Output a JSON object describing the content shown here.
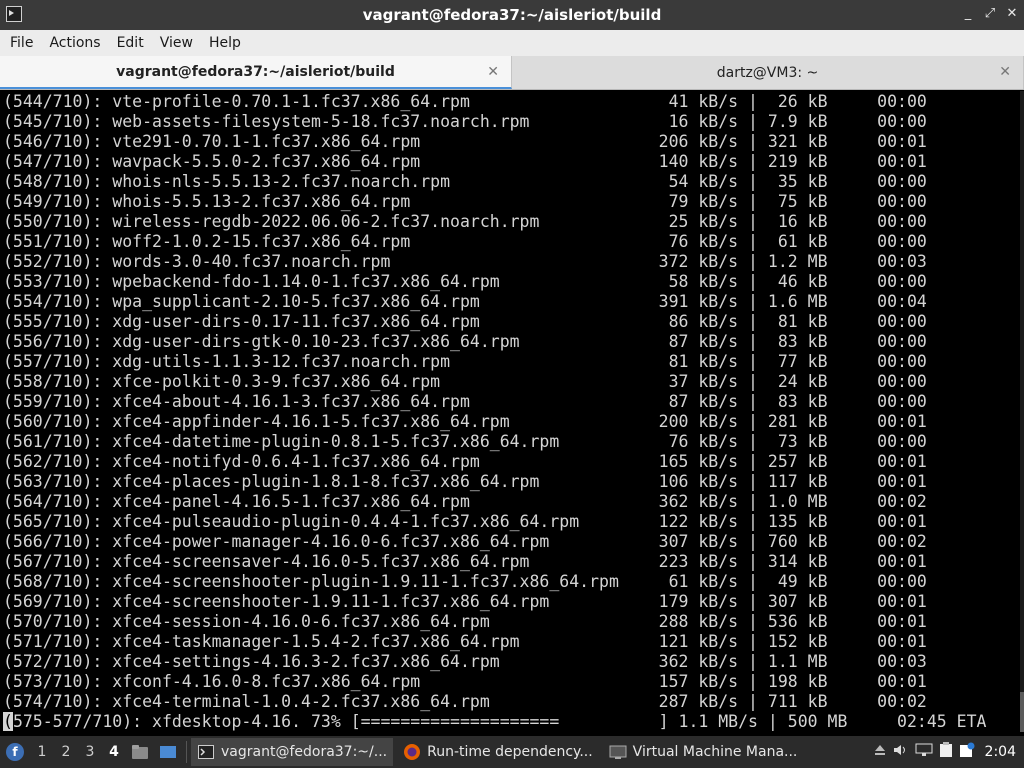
{
  "window": {
    "title": "vagrant@fedora37:~/aisleriot/build",
    "controls": [
      "_",
      "⤢",
      "✕"
    ]
  },
  "menubar": {
    "items": [
      "File",
      "Actions",
      "Edit",
      "View",
      "Help"
    ]
  },
  "tabs": [
    {
      "label": "vagrant@fedora37:~/aisleriot/build",
      "active": true
    },
    {
      "label": "dartz@VM3: ~",
      "active": false
    }
  ],
  "terminal": {
    "lines": [
      "(544/710): vte-profile-0.70.1-1.fc37.x86_64.rpm                    41 kB/s |  26 kB     00:00",
      "(545/710): web-assets-filesystem-5-18.fc37.noarch.rpm              16 kB/s | 7.9 kB     00:00",
      "(546/710): vte291-0.70.1-1.fc37.x86_64.rpm                        206 kB/s | 321 kB     00:01",
      "(547/710): wavpack-5.5.0-2.fc37.x86_64.rpm                        140 kB/s | 219 kB     00:01",
      "(548/710): whois-nls-5.5.13-2.fc37.noarch.rpm                      54 kB/s |  35 kB     00:00",
      "(549/710): whois-5.5.13-2.fc37.x86_64.rpm                          79 kB/s |  75 kB     00:00",
      "(550/710): wireless-regdb-2022.06.06-2.fc37.noarch.rpm             25 kB/s |  16 kB     00:00",
      "(551/710): woff2-1.0.2-15.fc37.x86_64.rpm                          76 kB/s |  61 kB     00:00",
      "(552/710): words-3.0-40.fc37.noarch.rpm                           372 kB/s | 1.2 MB     00:03",
      "(553/710): wpebackend-fdo-1.14.0-1.fc37.x86_64.rpm                 58 kB/s |  46 kB     00:00",
      "(554/710): wpa_supplicant-2.10-5.fc37.x86_64.rpm                  391 kB/s | 1.6 MB     00:04",
      "(555/710): xdg-user-dirs-0.17-11.fc37.x86_64.rpm                   86 kB/s |  81 kB     00:00",
      "(556/710): xdg-user-dirs-gtk-0.10-23.fc37.x86_64.rpm               87 kB/s |  83 kB     00:00",
      "(557/710): xdg-utils-1.1.3-12.fc37.noarch.rpm                      81 kB/s |  77 kB     00:00",
      "(558/710): xfce-polkit-0.3-9.fc37.x86_64.rpm                       37 kB/s |  24 kB     00:00",
      "(559/710): xfce4-about-4.16.1-3.fc37.x86_64.rpm                    87 kB/s |  83 kB     00:00",
      "(560/710): xfce4-appfinder-4.16.1-5.fc37.x86_64.rpm               200 kB/s | 281 kB     00:01",
      "(561/710): xfce4-datetime-plugin-0.8.1-5.fc37.x86_64.rpm           76 kB/s |  73 kB     00:00",
      "(562/710): xfce4-notifyd-0.6.4-1.fc37.x86_64.rpm                  165 kB/s | 257 kB     00:01",
      "(563/710): xfce4-places-plugin-1.8.1-8.fc37.x86_64.rpm            106 kB/s | 117 kB     00:01",
      "(564/710): xfce4-panel-4.16.5-1.fc37.x86_64.rpm                   362 kB/s | 1.0 MB     00:02",
      "(565/710): xfce4-pulseaudio-plugin-0.4.4-1.fc37.x86_64.rpm        122 kB/s | 135 kB     00:01",
      "(566/710): xfce4-power-manager-4.16.0-6.fc37.x86_64.rpm           307 kB/s | 760 kB     00:02",
      "(567/710): xfce4-screensaver-4.16.0-5.fc37.x86_64.rpm             223 kB/s | 314 kB     00:01",
      "(568/710): xfce4-screenshooter-plugin-1.9.11-1.fc37.x86_64.rpm     61 kB/s |  49 kB     00:00",
      "(569/710): xfce4-screenshooter-1.9.11-1.fc37.x86_64.rpm           179 kB/s | 307 kB     00:01",
      "(570/710): xfce4-session-4.16.0-6.fc37.x86_64.rpm                 288 kB/s | 536 kB     00:01",
      "(571/710): xfce4-taskmanager-1.5.4-2.fc37.x86_64.rpm              121 kB/s | 152 kB     00:01",
      "(572/710): xfce4-settings-4.16.3-2.fc37.x86_64.rpm                362 kB/s | 1.1 MB     00:03",
      "(573/710): xfconf-4.16.0-8.fc37.x86_64.rpm                        157 kB/s | 198 kB     00:01",
      "(574/710): xfce4-terminal-1.0.4-2.fc37.x86_64.rpm                 287 kB/s | 711 kB     00:02"
    ],
    "progress_cursor_char": "(",
    "progress_line": "575-577/710): xfdesktop-4.16. 73% [====================          ] 1.1 MB/s | 500 MB     02:45 ETA"
  },
  "taskbar": {
    "workspaces": [
      "1",
      "2",
      "3",
      "4"
    ],
    "active_workspace": "4",
    "tasks": [
      {
        "label": "vagrant@fedora37:~/...",
        "icon": "terminal-icon",
        "active": true
      },
      {
        "label": "Run-time dependency...",
        "icon": "firefox-icon",
        "active": false
      },
      {
        "label": "Virtual Machine Mana...",
        "icon": "virt-manager-icon",
        "active": false
      }
    ],
    "clock": "2:04"
  },
  "colors": {
    "titlebar_bg": "#3a3a3a",
    "terminal_bg": "#000000",
    "terminal_fg": "#d4d4d4",
    "taskbar_bg": "#2b2b2b",
    "fedora_blue": "#3c6eb4"
  }
}
